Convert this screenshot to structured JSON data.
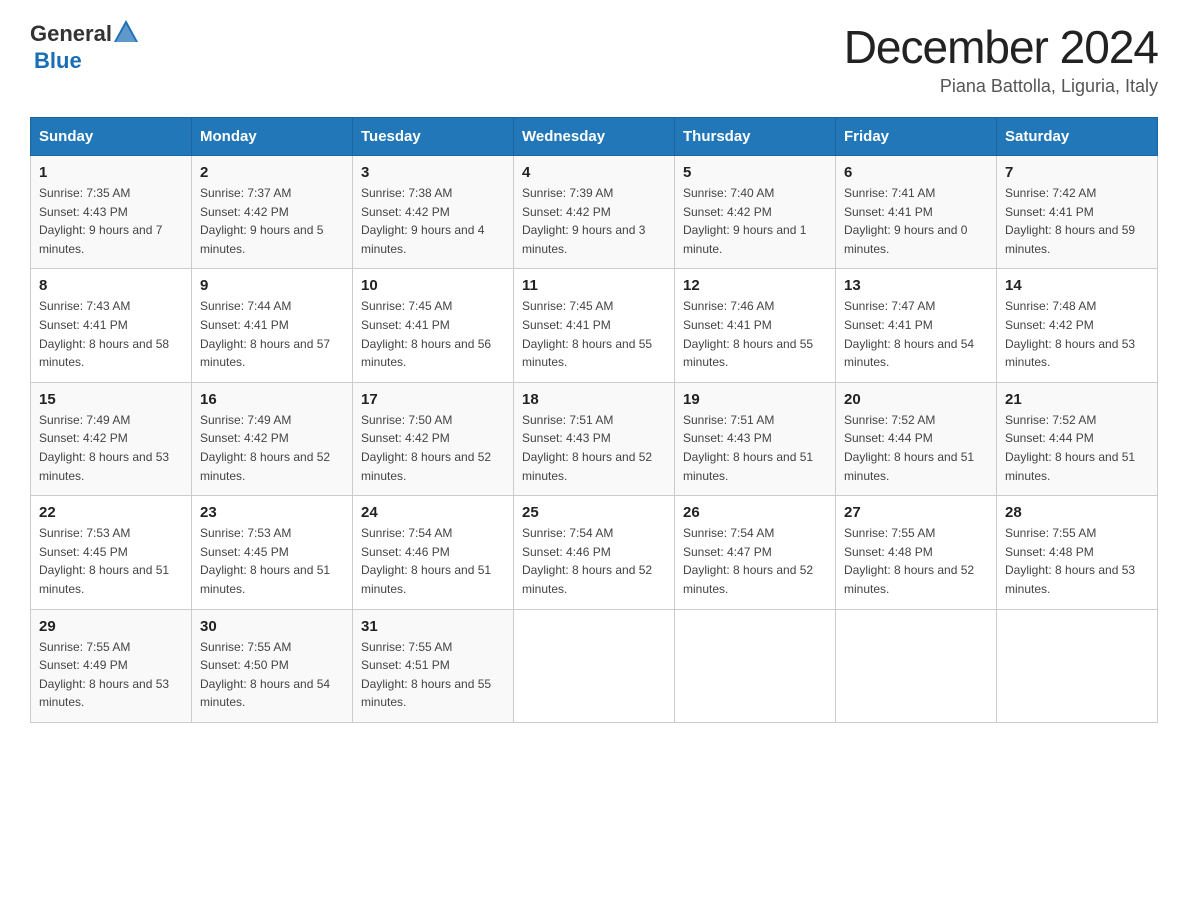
{
  "header": {
    "logo_general": "General",
    "logo_blue": "Blue",
    "month_title": "December 2024",
    "location": "Piana Battolla, Liguria, Italy"
  },
  "weekdays": [
    "Sunday",
    "Monday",
    "Tuesday",
    "Wednesday",
    "Thursday",
    "Friday",
    "Saturday"
  ],
  "weeks": [
    [
      {
        "day": "1",
        "sunrise": "7:35 AM",
        "sunset": "4:43 PM",
        "daylight": "9 hours and 7 minutes."
      },
      {
        "day": "2",
        "sunrise": "7:37 AM",
        "sunset": "4:42 PM",
        "daylight": "9 hours and 5 minutes."
      },
      {
        "day": "3",
        "sunrise": "7:38 AM",
        "sunset": "4:42 PM",
        "daylight": "9 hours and 4 minutes."
      },
      {
        "day": "4",
        "sunrise": "7:39 AM",
        "sunset": "4:42 PM",
        "daylight": "9 hours and 3 minutes."
      },
      {
        "day": "5",
        "sunrise": "7:40 AM",
        "sunset": "4:42 PM",
        "daylight": "9 hours and 1 minute."
      },
      {
        "day": "6",
        "sunrise": "7:41 AM",
        "sunset": "4:41 PM",
        "daylight": "9 hours and 0 minutes."
      },
      {
        "day": "7",
        "sunrise": "7:42 AM",
        "sunset": "4:41 PM",
        "daylight": "8 hours and 59 minutes."
      }
    ],
    [
      {
        "day": "8",
        "sunrise": "7:43 AM",
        "sunset": "4:41 PM",
        "daylight": "8 hours and 58 minutes."
      },
      {
        "day": "9",
        "sunrise": "7:44 AM",
        "sunset": "4:41 PM",
        "daylight": "8 hours and 57 minutes."
      },
      {
        "day": "10",
        "sunrise": "7:45 AM",
        "sunset": "4:41 PM",
        "daylight": "8 hours and 56 minutes."
      },
      {
        "day": "11",
        "sunrise": "7:45 AM",
        "sunset": "4:41 PM",
        "daylight": "8 hours and 55 minutes."
      },
      {
        "day": "12",
        "sunrise": "7:46 AM",
        "sunset": "4:41 PM",
        "daylight": "8 hours and 55 minutes."
      },
      {
        "day": "13",
        "sunrise": "7:47 AM",
        "sunset": "4:41 PM",
        "daylight": "8 hours and 54 minutes."
      },
      {
        "day": "14",
        "sunrise": "7:48 AM",
        "sunset": "4:42 PM",
        "daylight": "8 hours and 53 minutes."
      }
    ],
    [
      {
        "day": "15",
        "sunrise": "7:49 AM",
        "sunset": "4:42 PM",
        "daylight": "8 hours and 53 minutes."
      },
      {
        "day": "16",
        "sunrise": "7:49 AM",
        "sunset": "4:42 PM",
        "daylight": "8 hours and 52 minutes."
      },
      {
        "day": "17",
        "sunrise": "7:50 AM",
        "sunset": "4:42 PM",
        "daylight": "8 hours and 52 minutes."
      },
      {
        "day": "18",
        "sunrise": "7:51 AM",
        "sunset": "4:43 PM",
        "daylight": "8 hours and 52 minutes."
      },
      {
        "day": "19",
        "sunrise": "7:51 AM",
        "sunset": "4:43 PM",
        "daylight": "8 hours and 51 minutes."
      },
      {
        "day": "20",
        "sunrise": "7:52 AM",
        "sunset": "4:44 PM",
        "daylight": "8 hours and 51 minutes."
      },
      {
        "day": "21",
        "sunrise": "7:52 AM",
        "sunset": "4:44 PM",
        "daylight": "8 hours and 51 minutes."
      }
    ],
    [
      {
        "day": "22",
        "sunrise": "7:53 AM",
        "sunset": "4:45 PM",
        "daylight": "8 hours and 51 minutes."
      },
      {
        "day": "23",
        "sunrise": "7:53 AM",
        "sunset": "4:45 PM",
        "daylight": "8 hours and 51 minutes."
      },
      {
        "day": "24",
        "sunrise": "7:54 AM",
        "sunset": "4:46 PM",
        "daylight": "8 hours and 51 minutes."
      },
      {
        "day": "25",
        "sunrise": "7:54 AM",
        "sunset": "4:46 PM",
        "daylight": "8 hours and 52 minutes."
      },
      {
        "day": "26",
        "sunrise": "7:54 AM",
        "sunset": "4:47 PM",
        "daylight": "8 hours and 52 minutes."
      },
      {
        "day": "27",
        "sunrise": "7:55 AM",
        "sunset": "4:48 PM",
        "daylight": "8 hours and 52 minutes."
      },
      {
        "day": "28",
        "sunrise": "7:55 AM",
        "sunset": "4:48 PM",
        "daylight": "8 hours and 53 minutes."
      }
    ],
    [
      {
        "day": "29",
        "sunrise": "7:55 AM",
        "sunset": "4:49 PM",
        "daylight": "8 hours and 53 minutes."
      },
      {
        "day": "30",
        "sunrise": "7:55 AM",
        "sunset": "4:50 PM",
        "daylight": "8 hours and 54 minutes."
      },
      {
        "day": "31",
        "sunrise": "7:55 AM",
        "sunset": "4:51 PM",
        "daylight": "8 hours and 55 minutes."
      },
      null,
      null,
      null,
      null
    ]
  ]
}
